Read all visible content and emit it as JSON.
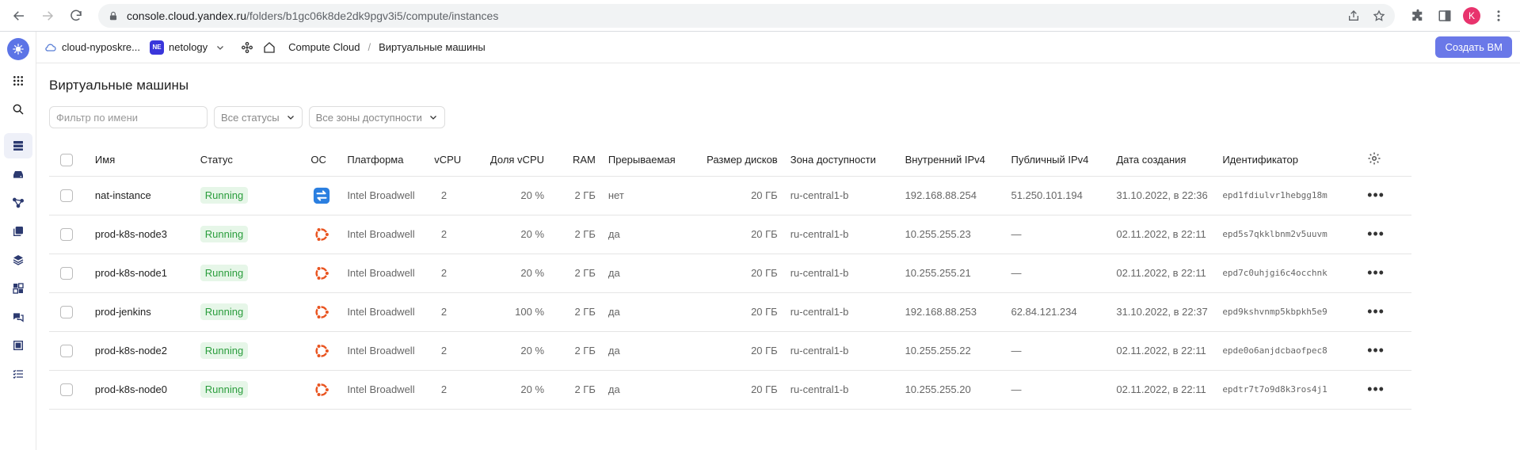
{
  "browser": {
    "url_host": "console.cloud.yandex.ru",
    "url_path": "/folders/b1gc06k8de2dk9pgv3i5/compute/instances",
    "profile_initial": "K"
  },
  "topbar": {
    "cloud_name": "cloud-nyposkre...",
    "folder_badge": "NE",
    "folder_name": "netology",
    "breadcrumb_service": "Compute Cloud",
    "breadcrumb_sep": "/",
    "breadcrumb_current": "Виртуальные машины",
    "create_button": "Создать ВМ"
  },
  "page": {
    "title": "Виртуальные машины",
    "filter_placeholder": "Фильтр по имени",
    "status_select": "Все статусы",
    "zone_select": "Все зоны доступности"
  },
  "table": {
    "headers": {
      "name": "Имя",
      "status": "Статус",
      "os": "ОС",
      "platform": "Платформа",
      "vcpu": "vCPU",
      "vcpu_share": "Доля vCPU",
      "ram": "RAM",
      "preemptible": "Прерываемая",
      "disk": "Размер дисков",
      "zone": "Зона доступности",
      "internal_ip": "Внутренний IPv4",
      "public_ip": "Публичный IPv4",
      "created": "Дата создания",
      "id": "Идентификатор"
    },
    "rows": [
      {
        "name": "nat-instance",
        "status": "Running",
        "os": "nat",
        "platform": "Intel Broadwell",
        "vcpu": "2",
        "share": "20 %",
        "ram": "2 ГБ",
        "preempt": "нет",
        "disk": "20 ГБ",
        "zone": "ru-central1-b",
        "internal_ip": "192.168.88.254",
        "public_ip": "51.250.101.194",
        "created": "31.10.2022, в 22:36",
        "id": "epd1fdiulvr1hebgg18m"
      },
      {
        "name": "prod-k8s-node3",
        "status": "Running",
        "os": "ubuntu",
        "platform": "Intel Broadwell",
        "vcpu": "2",
        "share": "20 %",
        "ram": "2 ГБ",
        "preempt": "да",
        "disk": "20 ГБ",
        "zone": "ru-central1-b",
        "internal_ip": "10.255.255.23",
        "public_ip": "—",
        "created": "02.11.2022, в 22:11",
        "id": "epd5s7qkklbnm2v5uuvm"
      },
      {
        "name": "prod-k8s-node1",
        "status": "Running",
        "os": "ubuntu",
        "platform": "Intel Broadwell",
        "vcpu": "2",
        "share": "20 %",
        "ram": "2 ГБ",
        "preempt": "да",
        "disk": "20 ГБ",
        "zone": "ru-central1-b",
        "internal_ip": "10.255.255.21",
        "public_ip": "—",
        "created": "02.11.2022, в 22:11",
        "id": "epd7c0uhjgi6c4occhnk"
      },
      {
        "name": "prod-jenkins",
        "status": "Running",
        "os": "ubuntu",
        "platform": "Intel Broadwell",
        "vcpu": "2",
        "share": "100 %",
        "ram": "2 ГБ",
        "preempt": "да",
        "disk": "20 ГБ",
        "zone": "ru-central1-b",
        "internal_ip": "192.168.88.253",
        "public_ip": "62.84.121.234",
        "created": "31.10.2022, в 22:37",
        "id": "epd9kshvnmp5kbpkh5e9"
      },
      {
        "name": "prod-k8s-node2",
        "status": "Running",
        "os": "ubuntu",
        "platform": "Intel Broadwell",
        "vcpu": "2",
        "share": "20 %",
        "ram": "2 ГБ",
        "preempt": "да",
        "disk": "20 ГБ",
        "zone": "ru-central1-b",
        "internal_ip": "10.255.255.22",
        "public_ip": "—",
        "created": "02.11.2022, в 22:11",
        "id": "epde0o6anjdcbaofpec8"
      },
      {
        "name": "prod-k8s-node0",
        "status": "Running",
        "os": "ubuntu",
        "platform": "Intel Broadwell",
        "vcpu": "2",
        "share": "20 %",
        "ram": "2 ГБ",
        "preempt": "да",
        "disk": "20 ГБ",
        "zone": "ru-central1-b",
        "internal_ip": "10.255.255.20",
        "public_ip": "—",
        "created": "02.11.2022, в 22:11",
        "id": "epdtr7t7o9d8k3ros4j1"
      }
    ]
  },
  "colors": {
    "accent": "#6a78e8",
    "status_bg": "#e6f6e8",
    "status_text": "#2a9d3c",
    "ubuntu": "#e95420",
    "nat": "#2b7fe0"
  }
}
